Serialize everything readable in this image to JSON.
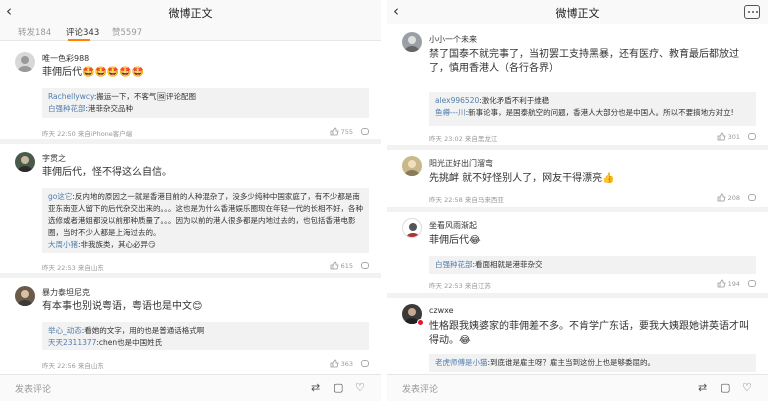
{
  "left": {
    "header": {
      "back_icon": "‹",
      "title": "微博正文"
    },
    "tabs": [
      {
        "label": "转发184",
        "active": false
      },
      {
        "label": "评论343",
        "active": true
      },
      {
        "label": "赞5597",
        "active": false
      }
    ],
    "comments": [
      {
        "user": "唯一色彩988",
        "text": "菲佣后代🤩🤩🤩🤩🤩",
        "quote": [
          {
            "user": "Rachellywcy",
            "text": ":搬运一下，不客气🖼评论配图"
          },
          {
            "user": "白强种花部",
            "text": ":港菲杂交品种"
          }
        ],
        "time": "昨天 22:50 来自iPhone客户端",
        "likes": "755"
      },
      {
        "user": "字贯之",
        "text": "菲佣后代，怪不得这么自信。",
        "quote": [
          {
            "user": "go这它",
            "text": ":反内地的原因之一就是香港目前的人种混杂了，没多少纯种中国家庭了，有不少都是南亚东南亚人留下的后代杂交出来的。。。这也是为什么香港娱乐圈现在年轻一代的长相不好，各种选修或者港姐都没以前那种质量了。。。因为以前的港人很多都是内地过去的，也包括香港电影圈，当时不少人都是上海过去的。"
          },
          {
            "user": "大周小猪",
            "text": ":非我族类，其心必异😏"
          }
        ],
        "time": "昨天 22:53 来自山东",
        "likes": "615"
      },
      {
        "user": "暴力泰坦尼克",
        "text": "有本事也别说粤语，粤语也是中文😊",
        "quote": [
          {
            "user": "举心_动态",
            "text": ":看她的文字，用的也是普通话格式啊"
          },
          {
            "user": "天天2311377",
            "text": ":chen也是中国姓氏"
          }
        ],
        "time": "昨天 22:56 来自山东",
        "likes": "363"
      }
    ],
    "footer": {
      "placeholder": "发表评论"
    }
  },
  "right": {
    "header": {
      "back_icon": "‹",
      "title": "微博正文"
    },
    "comments": [
      {
        "user": "小小一个未来",
        "text": "禁了国泰不就完事了，当初罢工支持黑暴，还有医疗、教育最后都放过了，慎用香港人（各行各界）",
        "quote": [
          {
            "user": "alex996520",
            "text": ":激化矛盾不利于维稳"
          },
          {
            "user": "鱼樽---川",
            "text": ":新事论事，是国泰航空的问题，香港人大部分也是中国人。所以不要搞地方对立!"
          }
        ],
        "time": "昨天 23:02 来自黑龙江",
        "likes": "301"
      },
      {
        "user": "阳光正好出门溜弯",
        "text": "先挑衅 就不好怪别人了，网友干得漂亮👍",
        "quote": [],
        "time": "昨天 22:58 来自马来西亚",
        "likes": "208"
      },
      {
        "user": "坐看风雨渐起",
        "text": "菲佣后代😂",
        "quote": [
          {
            "user": "白强种花部",
            "text": ":看面相就是港菲杂交"
          }
        ],
        "time": "昨天 22:53 来自江苏",
        "likes": "194"
      },
      {
        "user": "czwxe",
        "text": "性格跟我姨婆家的菲佣差不多。不肯学广东话，要我大姨跟她讲英语才叫得动。😂",
        "quote": [
          {
            "user": "老虎师傅是小猫",
            "text": ":到底谁是雇主呀？雇主当到这份上也是够委屈的。"
          }
        ],
        "time": "",
        "likes": ""
      }
    ],
    "footer": {
      "placeholder": "发表评论"
    }
  },
  "colors": {
    "accent": "#ff8200",
    "link": "#507daf",
    "muted": "#999999",
    "badge": "#e6162d"
  }
}
